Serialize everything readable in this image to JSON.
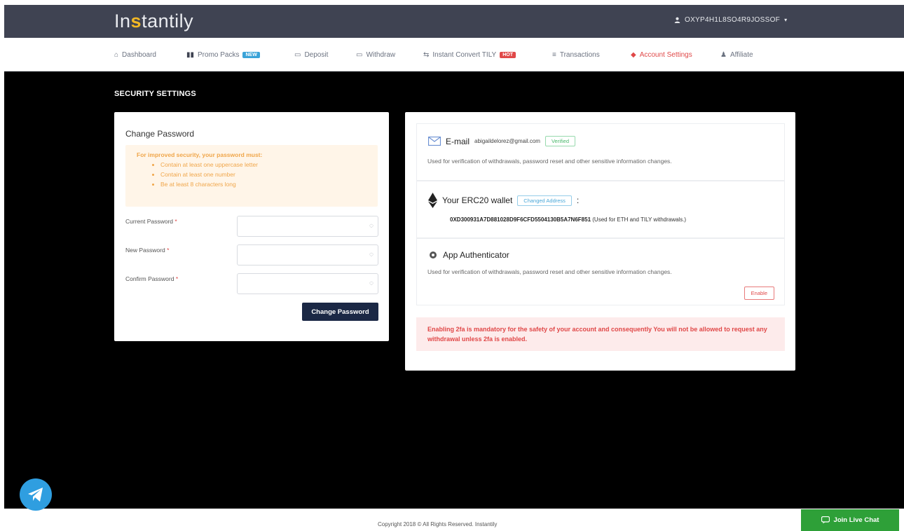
{
  "header": {
    "logo": {
      "pre": "In",
      "accent": "s",
      "post": "tantily"
    },
    "user": {
      "icon": "user-icon",
      "name": "OXYP4H1L8SO4R9JOSSOF"
    }
  },
  "nav": {
    "items": [
      {
        "icon": "home-icon",
        "label": "Dashboard"
      },
      {
        "icon": "box-icon",
        "label": "Promo Packs",
        "badge": "NEW"
      },
      {
        "icon": "deposit-icon",
        "label": "Deposit"
      },
      {
        "icon": "withdraw-icon",
        "label": "Withdraw"
      },
      {
        "icon": "convert-icon",
        "label": "Instant Convert TILY",
        "badge": "HOT"
      },
      {
        "icon": "list-icon",
        "label": "Transactions"
      },
      {
        "icon": "shield-icon",
        "label": "Account Settings"
      },
      {
        "icon": "users-icon",
        "label": "Affiliate"
      }
    ],
    "colors": {
      "active": "#e04848",
      "badge_new": "#3aa3d8",
      "badge_hot": "#e04848"
    }
  },
  "security": {
    "title": "SECURITY SETTINGS",
    "password": {
      "title": "Change Password",
      "rules_lead": "For improved security, your password must:",
      "rules": [
        "Contain at least one uppercase letter",
        "Contain at least one number",
        "Be at least 8 characters long"
      ],
      "current_label": "Current Password",
      "new_label": "New Password",
      "confirm_label": "Confirm Password",
      "required_mark": "*",
      "submit": "Change Password"
    },
    "email": {
      "title": "E-mail",
      "address": "abigaildelorez@gmail.com",
      "status": "Verified",
      "description": "Used for verification of withdrawals, password reset and other sensitive information changes."
    },
    "wallet": {
      "title": "Your ERC20 wallet",
      "action": "Changed Address",
      "separator": ":",
      "address": "0XD300931A7D881028D9F6CFD5504130B5A7N6F851",
      "note": "(Used for ETH and TILY withdrawals.)"
    },
    "authenticator": {
      "title": "App Authenticator",
      "description": "Used for verification of withdrawals, password reset and other sensitive information changes.",
      "action": "Enable"
    },
    "warning": "Enabling 2fa is mandatory for the safety of your account and consequently You will not be allowed to request any withdrawal unless 2fa is enabled."
  },
  "footer": {
    "copyright": "Copyright 2018 © All Rights Reserved. Instantily"
  },
  "chat": {
    "label": "Join Live Chat",
    "icon": "chat-icon"
  },
  "colors": {
    "topbar": "#3f4352",
    "navy_button": "#1b2845",
    "chat_green": "#2ea038",
    "telegram_blue": "#2f9ee0"
  }
}
